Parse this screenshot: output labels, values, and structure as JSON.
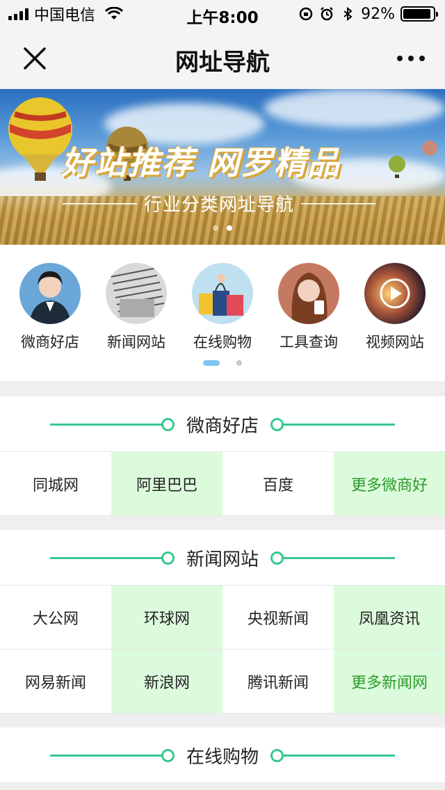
{
  "status_bar": {
    "carrier": "中国电信",
    "time": "上午8:00",
    "battery": "92%",
    "battery_level": 0.92
  },
  "nav": {
    "title": "网址导航",
    "close_icon": "close-icon",
    "more_icon": "more-icon"
  },
  "banner": {
    "title": "好站推荐  网罗精品",
    "subtitle": "行业分类网址导航",
    "slides": 2,
    "active_slide": 1
  },
  "categories": {
    "items": [
      {
        "label": "微商好店",
        "icon": "woman-headset-avatar"
      },
      {
        "label": "新闻网站",
        "icon": "newspaper-avatar"
      },
      {
        "label": "在线购物",
        "icon": "shopping-bags-avatar"
      },
      {
        "label": "工具查询",
        "icon": "woman-phone-avatar"
      },
      {
        "label": "视频网站",
        "icon": "play-video-avatar"
      }
    ],
    "pages": 2,
    "active_page": 0
  },
  "sections": [
    {
      "title": "微商好店",
      "links": [
        "同城网",
        "阿里巴巴",
        "百度",
        "更多微商好"
      ]
    },
    {
      "title": "新闻网站",
      "links": [
        "大公网",
        "环球网",
        "央视新闻",
        "凤凰资讯",
        "网易新闻",
        "新浪网",
        "腾讯新闻",
        "更多新闻网"
      ]
    },
    {
      "title": "在线购物",
      "links": []
    }
  ],
  "colors": {
    "accent": "#35c98f",
    "tint": "#dcfbdc",
    "more_link": "#2a9a2a",
    "dot_active": "#7cc6f0"
  }
}
